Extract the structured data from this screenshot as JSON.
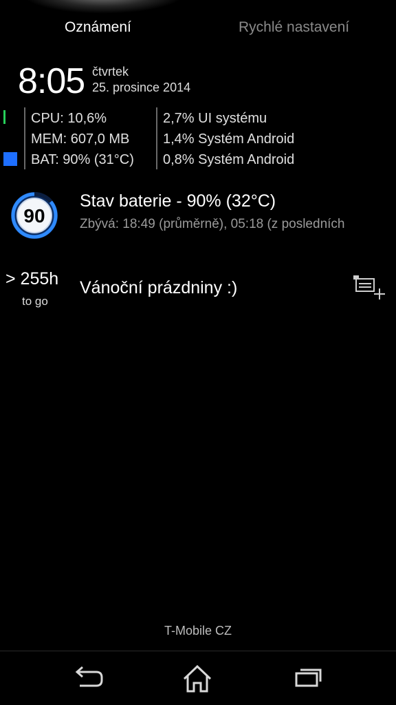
{
  "tabs": {
    "notifications": "Oznámení",
    "quick_settings": "Rychlé nastavení"
  },
  "clock": {
    "time": "8:05",
    "day": "čtvrtek",
    "date": "25. prosince 2014"
  },
  "system_monitor": {
    "cpu": "CPU: 10,6%",
    "mem": "MEM: 607,0 MB",
    "bat": "BAT: 90% (31°C)",
    "processes": [
      "2,7% UI systému",
      "1,4% Systém Android",
      "0,8% Systém Android"
    ],
    "cpu_color": "#27d05a",
    "bat_color": "#1e6fff"
  },
  "battery_notification": {
    "level": "90",
    "title": "Stav baterie - 90% (32°C)",
    "subtitle": "Zbývá: 18:49 (průměrně), 05:18 (z posledních"
  },
  "countdown_notification": {
    "value": "> 255h",
    "sub": "to go",
    "title": "Vánoční prázdniny :)"
  },
  "carrier": "T-Mobile CZ",
  "navbar": {
    "back": "back-icon",
    "home": "home-icon",
    "recents": "recents-icon"
  }
}
